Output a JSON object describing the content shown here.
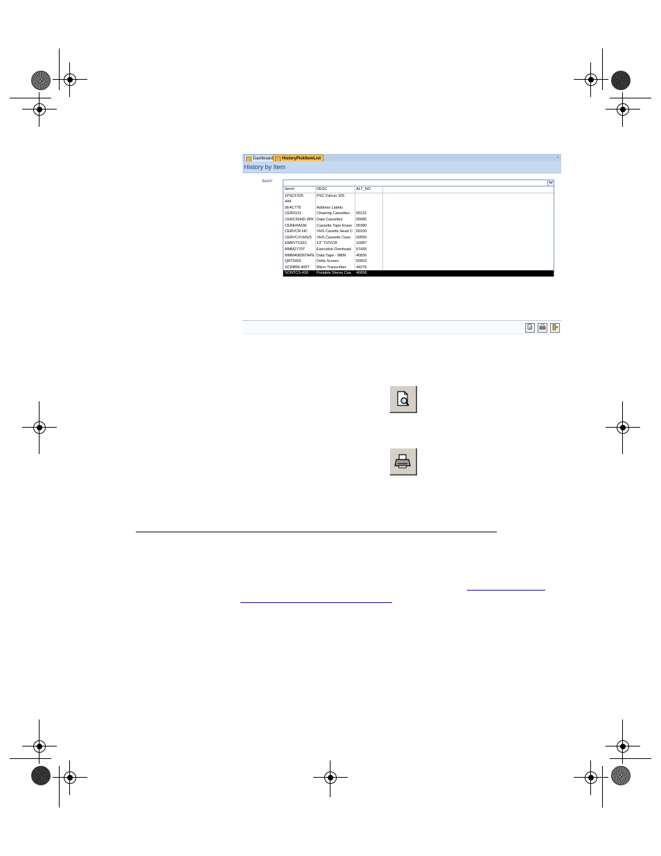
{
  "window": {
    "tabs": [
      {
        "label": "Dashboard",
        "active": false
      },
      {
        "label": "HistoryPickItemList",
        "active": true
      }
    ],
    "close_glyph": "×",
    "form_title": "History by Item"
  },
  "filter": {
    "label": "Item#",
    "combo_value": ""
  },
  "dropdown": {
    "columns": [
      "Item#",
      "DESC",
      "ALT_NO"
    ],
    "rows": [
      {
        "item": "1PSCF325",
        "desc": "PSC Falcon 325",
        "alt": "",
        "selected": false
      },
      {
        "item": "444",
        "desc": "",
        "alt": "",
        "selected": false
      },
      {
        "item": "5E4C778",
        "desc": "Address Labels",
        "alt": "",
        "selected": false
      },
      {
        "item": "CER0131",
        "desc": "Cleaning Cassettes",
        "alt": "00131",
        "selected": false
      },
      {
        "item": "CERC60HD-3PK",
        "desc": "Data Cassettes",
        "alt": "00680",
        "selected": false
      },
      {
        "item": "CERERASM",
        "desc": "Cassette Tape Erase",
        "alt": "00280",
        "selected": false
      },
      {
        "item": "CERVCR-HC",
        "desc": "VHS Casette Head C",
        "alt": "00100",
        "selected": false
      },
      {
        "item": "CERVCXVHS/3",
        "desc": "VHS Cassette Case",
        "alt": "00550",
        "selected": false
      },
      {
        "item": "EMRVT1922",
        "desc": "13\" TV/VCR",
        "alt": "10087",
        "selected": false
      },
      {
        "item": "MMM2770T",
        "desc": "Executive Overhead",
        "alt": "57435",
        "selected": false
      },
      {
        "item": "MMM40836TAPE",
        "desc": "Data Tape - 8MM",
        "alt": "40836",
        "selected": false
      },
      {
        "item": "QRT5002",
        "desc": "Delta Screen",
        "alt": "50002",
        "selected": false
      },
      {
        "item": "SCINBM-405T",
        "desc": "Micro Transcriber",
        "alt": "44276",
        "selected": false
      },
      {
        "item": "SONTCS-430",
        "desc": "Portable Stereo Cas",
        "alt": "40658",
        "selected": true
      }
    ]
  },
  "icons": {
    "footer": [
      "preview-icon",
      "print-icon",
      "close-form-icon"
    ],
    "large": [
      "print-preview-icon",
      "printer-icon"
    ]
  },
  "colors": {
    "tab_active": "#f6c45a",
    "form_header": "#c5d9f1",
    "selected_row": "#000000",
    "link": "#0000cc"
  }
}
